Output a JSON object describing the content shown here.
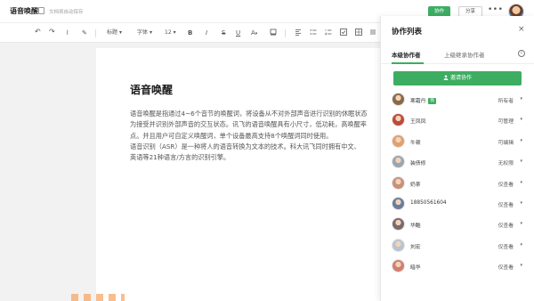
{
  "header": {
    "doc_title": "语音唤醒",
    "save_status": "文档将自动保存",
    "collab_label": "协作",
    "share_label": "分享",
    "more_label": "•••"
  },
  "toolbar": {
    "undo": "↶",
    "redo": "↷",
    "format_painter": "⌇",
    "clear_format": "✎",
    "heading": "标题",
    "font": "字体",
    "size": "12",
    "bold": "B",
    "italic": "I",
    "strike": "S",
    "underline": "U",
    "color": "A",
    "caret": "▾"
  },
  "document": {
    "title": "语音唤醒",
    "paragraphs": [
      "语音唤醒是指通过4~6个音节的唤醒词，将设备从不对外部声音进行识别的休眠状态",
      "为接受并识别外部声音的交互状态。讯飞的语音唤醒具有小尺寸，低功耗，高唤醒率",
      "点。并且用户可自定义唤醒词，单个设备最高支持8个唤醒词同时使用。",
      "语音识别（ASR）是一种将人的语音转换为文本的技术。科大讯飞同时拥有中文、",
      "英语等21种语言/方言的识别引擎。"
    ]
  },
  "panel": {
    "title": "协作列表",
    "close": "×",
    "tabs": [
      "本级协作者",
      "上级继承协作者"
    ],
    "info": "i",
    "invite_label": "邀请协作",
    "members": [
      {
        "name": "寒霜丹",
        "badge": "我",
        "role": "所有者",
        "avatar_color": "#8a6a4a"
      },
      {
        "name": "王凤凤",
        "role": "可管理",
        "avatar_color": "#c04a3a"
      },
      {
        "name": "牛顿",
        "role": "可编辑",
        "avatar_color": "#e0a070"
      },
      {
        "name": "装债修",
        "role": "无权限",
        "avatar_color": "#9aa6b0"
      },
      {
        "name": "奶茶",
        "role": "仅查看",
        "avatar_color": "#c8907a"
      },
      {
        "name": "18850561604",
        "role": "仅查看",
        "avatar_color": "#6a7e9a"
      },
      {
        "name": "华酷",
        "role": "仅查看",
        "avatar_color": "#7a6a6a"
      },
      {
        "name": "刘宏",
        "role": "仅查看",
        "avatar_color": "#b8c4d0"
      },
      {
        "name": "暗华",
        "role": "仅查看",
        "avatar_color": "#d08070"
      }
    ],
    "caret": "▾"
  },
  "colors": {
    "accent": "#3dad62"
  }
}
